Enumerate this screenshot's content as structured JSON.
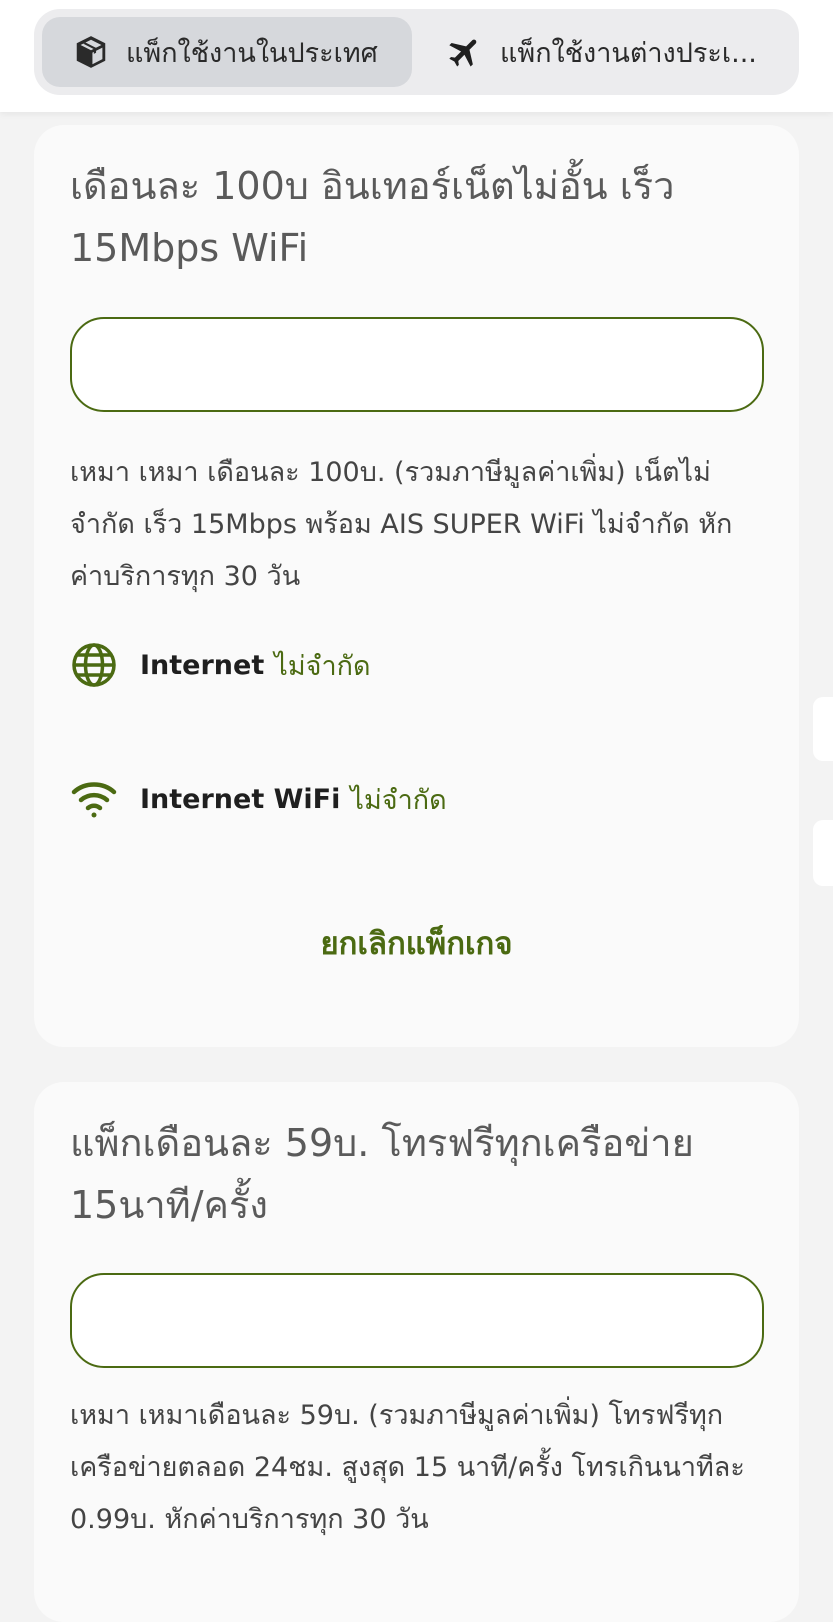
{
  "tabs": [
    {
      "label": "แพ็กใช้งานในประเทศ",
      "icon": "box-icon",
      "active": true
    },
    {
      "label": "แพ็กใช้งานต่างประเ...",
      "icon": "airplane-icon",
      "active": false
    }
  ],
  "packages": [
    {
      "title": "เดือนละ 100บ อินเทอร์เน็ตไม่อั้น เร็ว 15Mbps WiFi",
      "description": "เหมา เหมา เดือนละ 100บ. (รวมภาษีมูลค่าเพิ่ม) เน็ตไม่จำกัด เร็ว 15Mbps พร้อม AIS SUPER WiFi ไม่จำกัด หักค่าบริการทุก 30 วัน",
      "features": [
        {
          "icon": "globe-icon",
          "label": "Internet",
          "value": "ไม่จำกัด"
        },
        {
          "icon": "wifi-icon",
          "label": "Internet WiFi",
          "value": "ไม่จำกัด"
        }
      ],
      "cancel_label": "ยกเลิกแพ็กเกจ"
    },
    {
      "title": "แพ็กเดือนละ 59บ. โทรฟรีทุกเครือข่าย 15นาที/ครั้ง",
      "description": "เหมา เหมาเดือนละ 59บ. (รวมภาษีมูลค่าเพิ่ม) โทรฟรีทุกเครือข่ายตลอด 24ชม. สูงสุด 15 นาที/ครั้ง โทรเกินนาทีละ 0.99บ. หักค่าบริการทุก 30 วัน"
    }
  ],
  "colors": {
    "accent": "#4b6a12",
    "background": "#f3f3f3",
    "card": "#fafafa"
  }
}
